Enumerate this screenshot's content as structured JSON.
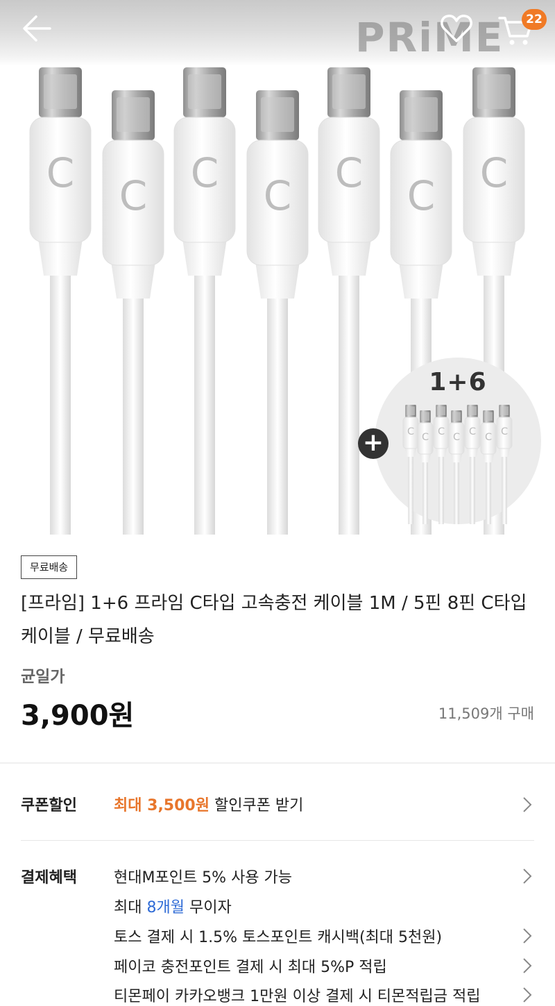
{
  "header": {
    "brand_logo": "PRiME",
    "cart_count": "22"
  },
  "hero": {
    "bundle_label": "1+6",
    "plus_symbol": "+",
    "cable_letter": "C"
  },
  "product": {
    "shipping_tag": "무료배송",
    "title": "[프라임] 1+6 프라임 C타입 고속충전 케이블 1M / 5핀 8핀 C타입 케이블 / 무료배송",
    "price_label": "균일가",
    "price": "3,900원",
    "sold_count": "11,509개 구매"
  },
  "coupon": {
    "label": "쿠폰할인",
    "highlight": "최대 3,500원",
    "text": " 할인쿠폰 받기"
  },
  "payment": {
    "label": "결제혜택",
    "benefits": [
      {
        "text": "현대M포인트 5% 사용 가능"
      },
      {
        "prefix": "최대 ",
        "highlight": "8개월",
        "suffix": " 무이자"
      },
      {
        "text": "토스 결제 시 1.5% 토스포인트 캐시백(최대 5천원)"
      },
      {
        "text": "페이코 충전포인트 결제 시 최대 5%P 적립"
      },
      {
        "text": "티몬페이 카카오뱅크 1만원 이상 결제 시 티몬적립금 적립"
      }
    ]
  },
  "icons": {
    "back": "back-arrow-icon",
    "heart": "heart-icon",
    "cart": "cart-icon",
    "chevron": "chevron-right-icon"
  },
  "colors": {
    "accent_orange": "#e8762c",
    "badge_orange": "#f07a25",
    "link_blue": "#2f6bd6"
  }
}
